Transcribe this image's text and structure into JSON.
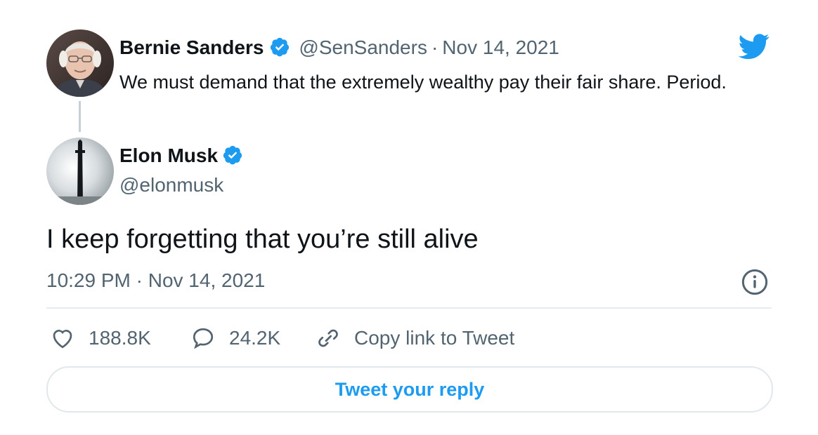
{
  "parent_tweet": {
    "author_name": "Bernie Sanders",
    "handle": "@SenSanders",
    "separator": "·",
    "date": "Nov 14, 2021",
    "text": "We must demand that the extremely wealthy pay their fair share. Period."
  },
  "reply_tweet": {
    "author_name": "Elon Musk",
    "handle": "@elonmusk",
    "text": "I keep forgetting that you’re still alive",
    "timestamp": "10:29 PM · Nov 14, 2021"
  },
  "actions": {
    "likes": "188.8K",
    "replies": "24.2K",
    "copy_link": "Copy link to Tweet"
  },
  "reply_button": {
    "label": "Tweet your reply"
  },
  "icons": {
    "brand": "twitter-bird-icon",
    "verified": "verified-badge-icon",
    "info": "info-icon",
    "like": "heart-icon",
    "reply": "speech-bubble-icon",
    "link": "link-icon"
  },
  "colors": {
    "brand_blue": "#1d9bf0",
    "text_primary": "#0f1419",
    "text_secondary": "#536471",
    "divider": "#e6ecf0",
    "thread_line": "#c4cfd6"
  }
}
